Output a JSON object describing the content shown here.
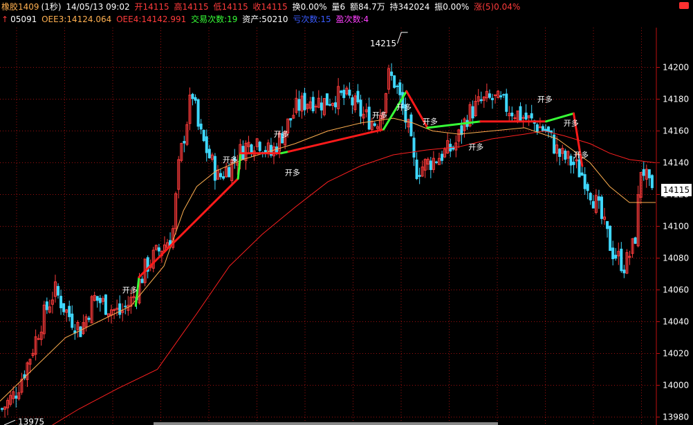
{
  "header": {
    "symbol": "橡胶1409",
    "period": "(1秒)",
    "datetime": "14/05/13 09:02",
    "open": "开14115",
    "high": "高14115",
    "low": "低14115",
    "close": "收14115",
    "turnover": "换0.00%",
    "volume": "量6",
    "amount": "额84.7万",
    "hold": "持342024",
    "amplitude": "振0.00%",
    "change": "涨(5)0.04%",
    "code": "05091",
    "oee3": "OEE3:14124.064",
    "oee4": "OEE4:14142.991",
    "trades": "交易次数:19",
    "assets": "资产:50210",
    "losses": "亏次数:15",
    "wins": "盈次数:4"
  },
  "colors": {
    "background": "#000000",
    "grid": "#a01010",
    "up": "#ff3b3b",
    "down": "#3fd8ff",
    "oee3": "#ffb050",
    "oee4": "#ff2020",
    "trade_long": "#ff1a1a",
    "trade_short": "#37ff37",
    "text": "#ffffff"
  },
  "icons": {
    "arrow": "up-arrow-icon",
    "settings": "settings-icon"
  },
  "chart_data": {
    "type": "candlestick",
    "ylim": [
      13975,
      14225
    ],
    "yticks": [
      13980,
      14000,
      14020,
      14040,
      14060,
      14080,
      14100,
      14120,
      14140,
      14160,
      14180,
      14200
    ],
    "current_price": "14115",
    "max_label": "14215",
    "min_label": "13975",
    "price_path": [
      [
        0.0,
        13985
      ],
      [
        0.02,
        13995
      ],
      [
        0.04,
        14015
      ],
      [
        0.06,
        14040
      ],
      [
        0.08,
        14060
      ],
      [
        0.1,
        14045
      ],
      [
        0.12,
        14035
      ],
      [
        0.14,
        14055
      ],
      [
        0.16,
        14050
      ],
      [
        0.18,
        14045
      ],
      [
        0.2,
        14055
      ],
      [
        0.22,
        14075
      ],
      [
        0.24,
        14085
      ],
      [
        0.26,
        14095
      ],
      [
        0.27,
        14140
      ],
      [
        0.29,
        14185
      ],
      [
        0.3,
        14160
      ],
      [
        0.31,
        14150
      ],
      [
        0.32,
        14140
      ],
      [
        0.33,
        14130
      ],
      [
        0.35,
        14140
      ],
      [
        0.37,
        14150
      ],
      [
        0.39,
        14155
      ],
      [
        0.41,
        14145
      ],
      [
        0.43,
        14160
      ],
      [
        0.45,
        14175
      ],
      [
        0.47,
        14180
      ],
      [
        0.49,
        14178
      ],
      [
        0.51,
        14182
      ],
      [
        0.53,
        14180
      ],
      [
        0.55,
        14170
      ],
      [
        0.57,
        14165
      ],
      [
        0.58,
        14175
      ],
      [
        0.59,
        14195
      ],
      [
        0.6,
        14190
      ],
      [
        0.61,
        14175
      ],
      [
        0.62,
        14160
      ],
      [
        0.63,
        14135
      ],
      [
        0.65,
        14140
      ],
      [
        0.67,
        14145
      ],
      [
        0.69,
        14150
      ],
      [
        0.71,
        14170
      ],
      [
        0.73,
        14178
      ],
      [
        0.75,
        14180
      ],
      [
        0.77,
        14175
      ],
      [
        0.79,
        14170
      ],
      [
        0.81,
        14165
      ],
      [
        0.83,
        14160
      ],
      [
        0.85,
        14145
      ],
      [
        0.87,
        14140
      ],
      [
        0.89,
        14130
      ],
      [
        0.91,
        14110
      ],
      [
        0.93,
        14085
      ],
      [
        0.95,
        14075
      ],
      [
        0.965,
        14090
      ],
      [
        0.975,
        14140
      ],
      [
        0.99,
        14120
      ],
      [
        1.0,
        14110
      ]
    ],
    "oee3_path": [
      [
        0.0,
        13990
      ],
      [
        0.05,
        14010
      ],
      [
        0.1,
        14030
      ],
      [
        0.15,
        14040
      ],
      [
        0.2,
        14050
      ],
      [
        0.25,
        14075
      ],
      [
        0.28,
        14110
      ],
      [
        0.3,
        14125
      ],
      [
        0.33,
        14135
      ],
      [
        0.37,
        14142
      ],
      [
        0.41,
        14147
      ],
      [
        0.45,
        14152
      ],
      [
        0.5,
        14160
      ],
      [
        0.55,
        14165
      ],
      [
        0.6,
        14168
      ],
      [
        0.63,
        14165
      ],
      [
        0.66,
        14160
      ],
      [
        0.7,
        14158
      ],
      [
        0.75,
        14160
      ],
      [
        0.8,
        14162
      ],
      [
        0.85,
        14155
      ],
      [
        0.9,
        14140
      ],
      [
        0.93,
        14125
      ],
      [
        0.96,
        14115
      ],
      [
        1.0,
        14115
      ]
    ],
    "oee4_path": [
      [
        0.08,
        13975
      ],
      [
        0.12,
        13985
      ],
      [
        0.18,
        13998
      ],
      [
        0.24,
        14010
      ],
      [
        0.3,
        14045
      ],
      [
        0.35,
        14075
      ],
      [
        0.4,
        14095
      ],
      [
        0.45,
        14112
      ],
      [
        0.5,
        14128
      ],
      [
        0.55,
        14138
      ],
      [
        0.6,
        14145
      ],
      [
        0.65,
        14148
      ],
      [
        0.7,
        14150
      ],
      [
        0.75,
        14155
      ],
      [
        0.8,
        14158
      ],
      [
        0.83,
        14160
      ],
      [
        0.86,
        14157
      ],
      [
        0.9,
        14152
      ],
      [
        0.93,
        14146
      ],
      [
        0.96,
        14142
      ],
      [
        1.0,
        14140
      ]
    ],
    "trade_segments": [
      {
        "x1": 0.207,
        "y1": 14050,
        "x2": 0.212,
        "y2": 14068,
        "side": "short"
      },
      {
        "x1": 0.212,
        "y1": 14068,
        "x2": 0.363,
        "y2": 14130,
        "side": "long"
      },
      {
        "x1": 0.363,
        "y1": 14130,
        "x2": 0.367,
        "y2": 14146,
        "side": "short"
      },
      {
        "x1": 0.367,
        "y1": 14146,
        "x2": 0.429,
        "y2": 14146,
        "side": "long"
      },
      {
        "x1": 0.429,
        "y1": 14146,
        "x2": 0.44,
        "y2": 14147,
        "side": "short"
      },
      {
        "x1": 0.44,
        "y1": 14147,
        "x2": 0.585,
        "y2": 14161,
        "side": "long"
      },
      {
        "x1": 0.585,
        "y1": 14161,
        "x2": 0.62,
        "y2": 14185,
        "side": "short"
      },
      {
        "x1": 0.62,
        "y1": 14185,
        "x2": 0.652,
        "y2": 14162,
        "side": "long"
      },
      {
        "x1": 0.652,
        "y1": 14162,
        "x2": 0.733,
        "y2": 14166,
        "side": "short"
      },
      {
        "x1": 0.733,
        "y1": 14166,
        "x2": 0.833,
        "y2": 14166,
        "side": "long"
      },
      {
        "x1": 0.833,
        "y1": 14166,
        "x2": 0.875,
        "y2": 14171,
        "side": "short"
      },
      {
        "x1": 0.875,
        "y1": 14171,
        "x2": 0.888,
        "y2": 14138,
        "side": "long"
      }
    ],
    "trade_markers": [
      {
        "x": 0.197,
        "y": 14060,
        "label": "开多"
      },
      {
        "x": 0.35,
        "y": 14142,
        "label": "开多"
      },
      {
        "x": 0.428,
        "y": 14158,
        "label": "开多"
      },
      {
        "x": 0.445,
        "y": 14134,
        "label": "开多"
      },
      {
        "x": 0.578,
        "y": 14170,
        "label": "开多"
      },
      {
        "x": 0.615,
        "y": 14175,
        "label": "开多"
      },
      {
        "x": 0.655,
        "y": 14166,
        "label": "开多"
      },
      {
        "x": 0.725,
        "y": 14150,
        "label": "开多"
      },
      {
        "x": 0.83,
        "y": 14180,
        "label": "开多"
      },
      {
        "x": 0.87,
        "y": 14165,
        "label": "开多"
      },
      {
        "x": 0.885,
        "y": 14145,
        "label": "开多"
      }
    ]
  }
}
